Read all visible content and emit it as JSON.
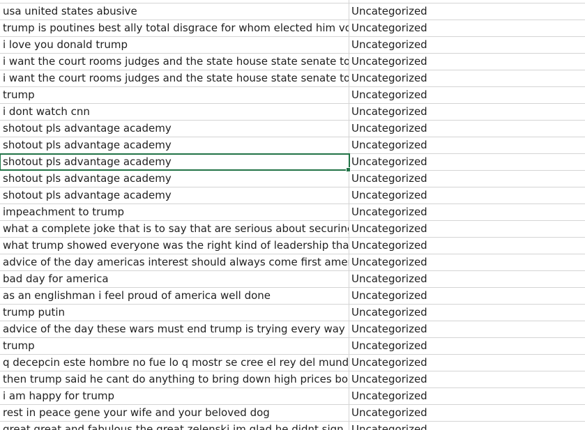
{
  "spreadsheet": {
    "rows": [
      {
        "text": "usa united states abusive",
        "category": "Uncategorized"
      },
      {
        "text": "trump is poutines best ally total disgrace for whom elected him vote",
        "category": "Uncategorized"
      },
      {
        "text": "i love you donald trump",
        "category": "Uncategorized"
      },
      {
        "text": "i want the court rooms judges and the state house state senate to m",
        "category": "Uncategorized"
      },
      {
        "text": "i want the court rooms judges and the state house state senate to m",
        "category": "Uncategorized"
      },
      {
        "text": "trump",
        "category": "Uncategorized"
      },
      {
        "text": "i dont watch cnn",
        "category": "Uncategorized"
      },
      {
        "text": "shotout pls advantage academy",
        "category": "Uncategorized"
      },
      {
        "text": "shotout pls advantage academy",
        "category": "Uncategorized"
      },
      {
        "text": "shotout pls advantage academy",
        "category": "Uncategorized"
      },
      {
        "text": "shotout pls advantage academy",
        "category": "Uncategorized"
      },
      {
        "text": "shotout pls advantage academy",
        "category": "Uncategorized"
      },
      {
        "text": "impeachment to trump",
        "category": "Uncategorized"
      },
      {
        "text": "what a complete joke that is to say that are serious about securing t",
        "category": "Uncategorized"
      },
      {
        "text": "what trump showed everyone was the right kind of leadership that a",
        "category": "Uncategorized"
      },
      {
        "text": "advice of the day americas interest should always come first americ",
        "category": "Uncategorized"
      },
      {
        "text": "bad day for america",
        "category": "Uncategorized"
      },
      {
        "text": "as an englishman i feel proud of america well done",
        "category": "Uncategorized"
      },
      {
        "text": "trump putin",
        "category": "Uncategorized"
      },
      {
        "text": "advice of the day these wars must end trump is trying every way pos",
        "category": "Uncategorized"
      },
      {
        "text": "trump",
        "category": "Uncategorized"
      },
      {
        "text": "q decepcin este hombre no fue lo q mostr se cree el rey del mundo",
        "category": "Uncategorized"
      },
      {
        "text": "then trump said he cant do anything to bring down high prices booo",
        "category": "Uncategorized"
      },
      {
        "text": "i am happy for trump",
        "category": "Uncategorized"
      },
      {
        "text": "rest in peace gene your wife and your beloved dog",
        "category": "Uncategorized"
      },
      {
        "text": "great great and fabulous the great zelenski im glad he didnt sign",
        "category": "Uncategorized"
      }
    ],
    "selected_row_index": 9,
    "colors": {
      "gridline": "#d4d4d4",
      "selection": "#217346",
      "text": "#1f1f1f"
    }
  }
}
